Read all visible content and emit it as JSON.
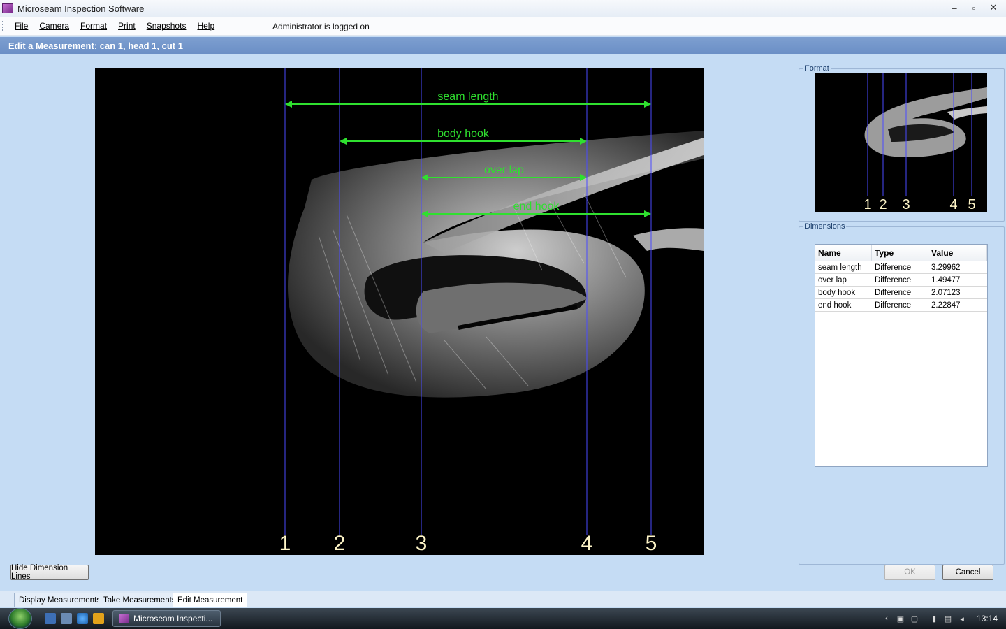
{
  "window": {
    "title": "Microseam Inspection Software",
    "minimize": "–",
    "maximize": "▫",
    "close": "✕"
  },
  "menu": {
    "items": [
      "File",
      "Camera",
      "Format",
      "Print",
      "Snapshots",
      "Help"
    ],
    "status": "Administrator is logged on"
  },
  "header": {
    "title": "Edit a Measurement: can 1, head 1, cut 1"
  },
  "main_image": {
    "dimensions": [
      {
        "label": "seam length",
        "from": 1,
        "to": 5
      },
      {
        "label": "body hook",
        "from": 2,
        "to": 4
      },
      {
        "label": "over lap",
        "from": 3,
        "to": 4
      },
      {
        "label": "end hook",
        "from": 3,
        "to": 5
      }
    ],
    "line_numbers": [
      "1",
      "2",
      "3",
      "4",
      "5"
    ],
    "dimension_color": "#2fe02f",
    "guide_color": "#4a4aff"
  },
  "format": {
    "legend": "Format",
    "line_numbers": [
      "1",
      "2",
      "3",
      "4",
      "5"
    ]
  },
  "dimensions": {
    "legend": "Dimensions",
    "columns": [
      "Name",
      "Type",
      "Value"
    ],
    "rows": [
      {
        "name": "seam length",
        "type": "Difference",
        "value": "3.29962"
      },
      {
        "name": "over lap",
        "type": "Difference",
        "value": "1.49477"
      },
      {
        "name": "body hook",
        "type": "Difference",
        "value": "2.07123"
      },
      {
        "name": "end hook",
        "type": "Difference",
        "value": "2.22847"
      }
    ]
  },
  "buttons": {
    "hide_lines": "Hide Dimension Lines",
    "ok": "OK",
    "cancel": "Cancel"
  },
  "tabs": [
    "Display Measurements",
    "Take Measurements",
    "Edit Measurement"
  ],
  "taskbar": {
    "task_label": "Microseam Inspecti...",
    "clock": "13:14"
  }
}
